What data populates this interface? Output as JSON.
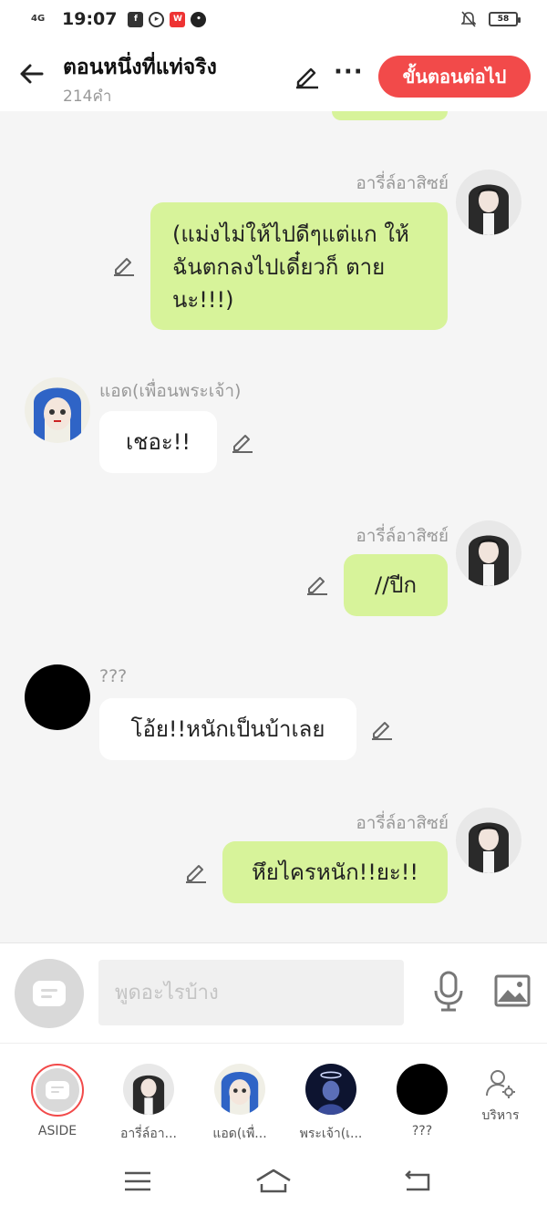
{
  "status_bar": {
    "network": "4G",
    "time": "19:07",
    "battery": "58",
    "icons": [
      "facebook-icon",
      "play-icon",
      "webtoon-icon",
      "ghost-icon",
      "mute-icon"
    ]
  },
  "header": {
    "title": "ตอนหนึ่งที่แท่จริง",
    "word_count": "214คำ",
    "next_button": "ขั้นตอนต่อไป"
  },
  "messages": [
    {
      "id": 1,
      "sender": "อารี่ล์อาสิซย์",
      "side": "right",
      "text": "(แม่งไม่ให้ไปดีๆแต่แก ให้ฉันตกลงไปเดี๋ยวก็ ตายนะ!!!)"
    },
    {
      "id": 2,
      "sender": "แอด(เพื่อนพระเจ้า)",
      "side": "left",
      "text": "เชอะ!!"
    },
    {
      "id": 3,
      "sender": "อารี่ล์อาสิซย์",
      "side": "right",
      "text": "//ปีก"
    },
    {
      "id": 4,
      "sender": "???",
      "side": "left",
      "text": "โอ้ย!!หนักเป็นบ้าเลย"
    },
    {
      "id": 5,
      "sender": "อารี่ล์อาสิซย์",
      "side": "right",
      "text": "หึยไครหนัก!!ยะ!!"
    }
  ],
  "input": {
    "placeholder": "พูดอะไรบ้าง"
  },
  "characters": [
    {
      "label": "ASIDE"
    },
    {
      "label": "อารี่ล์อา..."
    },
    {
      "label": "แอด(เพื่..."
    },
    {
      "label": "พระเจ้า(เ..."
    },
    {
      "label": "???"
    },
    {
      "label": "บริหาร"
    }
  ],
  "colors": {
    "accent": "#f24a4a",
    "bubble_self": "#d7f39a",
    "bubble_other": "#ffffff",
    "chat_bg": "#f5f5f5"
  }
}
